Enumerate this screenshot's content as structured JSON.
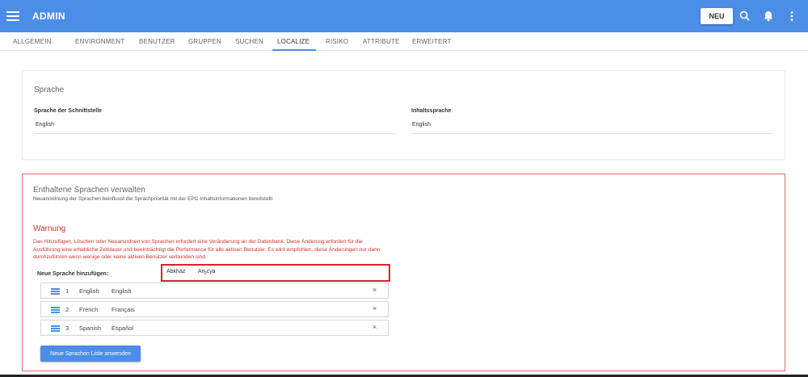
{
  "appbar": {
    "title": "ADMIN",
    "new_button": "NEU",
    "icons": [
      "menu-icon",
      "search-icon",
      "bell-icon",
      "more-vert-icon"
    ],
    "color": "#4c8de8"
  },
  "tabs": [
    {
      "label": "ALLGEMEIN"
    },
    {
      "label": "ENVIRONMENT"
    },
    {
      "label": "BENUTZER"
    },
    {
      "label": "GRUPPEN"
    },
    {
      "label": "SUCHEN"
    },
    {
      "label": "LOCALIZE"
    },
    {
      "label": "RISIKO"
    },
    {
      "label": "ATTRIBUTE"
    },
    {
      "label": "ERWEITERT"
    }
  ],
  "active_tab": "LOCALIZE",
  "language_card": {
    "heading": "Sprache",
    "interface_label": "Sprache der Schnittstelle",
    "interface_value": "English",
    "content_label": "Inhaltssprache",
    "content_value": "English"
  },
  "manage_card": {
    "heading": "Enthaltene Sprachen verwalten",
    "subheading": "Neuanordnung der Sprachen beinflusst die Sprachpriorität mit der EPC Inhaltsinformationen bereitstellt",
    "warning_heading": "Warnung",
    "warning_text": "Das Hinzufügen, Löschen oder Neuanordnen von Sprachen erfordert eine Veränderung an der Datenbank. Diese Änderung erfordert für die Ausführung eine erhebliche Zeitdauer und beeinträchtigt die Performance für alle aktiven Benutzer. Es wird empfohlen, diese Änderungen nur dann durchzuführen wenn wenige oder keine aktiven Benutzer verbunden sind.",
    "add_label": "Neue Sprache hinzufügen:",
    "add_select": {
      "name": "Abkhaz",
      "native": "Аҧсуа"
    },
    "languages": [
      {
        "num": "1",
        "name": "English",
        "native": "English"
      },
      {
        "num": "2",
        "name": "French",
        "native": "Français"
      },
      {
        "num": "3",
        "name": "Spanish",
        "native": "Español"
      }
    ],
    "remove_glyph": "×",
    "apply_button": "Neue Sprachen Liste anwenden",
    "border_color": "#e46c6c",
    "warning_color": "#d32f2f"
  }
}
